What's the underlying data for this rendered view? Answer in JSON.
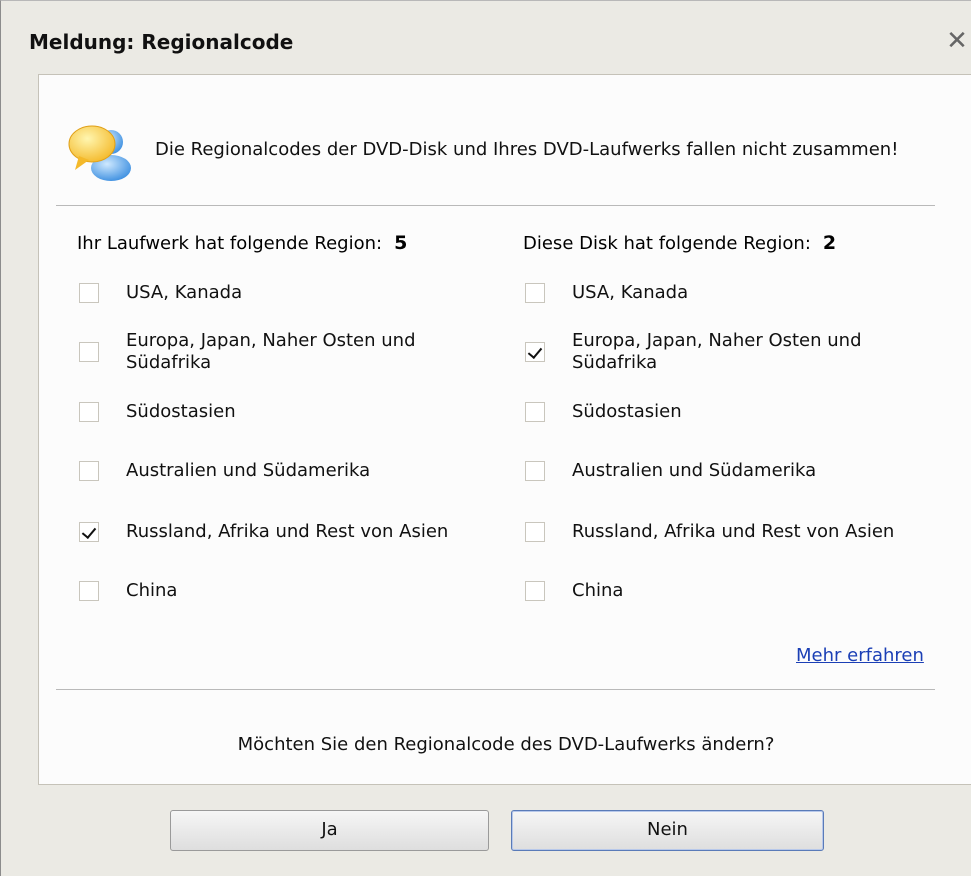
{
  "dialog": {
    "title": "Meldung: Regionalcode",
    "close_glyph": "✕",
    "message": "Die Regionalcodes der DVD-Disk und Ihres DVD-Laufwerks fallen nicht zusammen!",
    "icon": "chat-bubble-user-icon"
  },
  "drive": {
    "heading": "Ihr Laufwerk hat folgende Region:",
    "region": "5",
    "options": [
      {
        "label": "USA, Kanada",
        "checked": false
      },
      {
        "label": "Europa, Japan, Naher Osten und Südafrika",
        "checked": false
      },
      {
        "label": "Südostasien",
        "checked": false
      },
      {
        "label": "Australien und Südamerika",
        "checked": false
      },
      {
        "label": "Russland, Afrika und Rest von Asien",
        "checked": true
      },
      {
        "label": "China",
        "checked": false
      }
    ]
  },
  "disk": {
    "heading": "Diese Disk hat folgende Region:",
    "region": "2",
    "options": [
      {
        "label": "USA, Kanada",
        "checked": false
      },
      {
        "label": "Europa, Japan, Naher Osten und Südafrika",
        "checked": true
      },
      {
        "label": "Südostasien",
        "checked": false
      },
      {
        "label": "Australien und Südamerika",
        "checked": false
      },
      {
        "label": "Russland, Afrika und Rest von Asien",
        "checked": false
      },
      {
        "label": "China",
        "checked": false
      }
    ]
  },
  "more_link": "Mehr erfahren",
  "question": "Möchten Sie den Regionalcode des DVD-Laufwerks ändern?",
  "buttons": {
    "yes": "Ja",
    "no": "Nein"
  }
}
